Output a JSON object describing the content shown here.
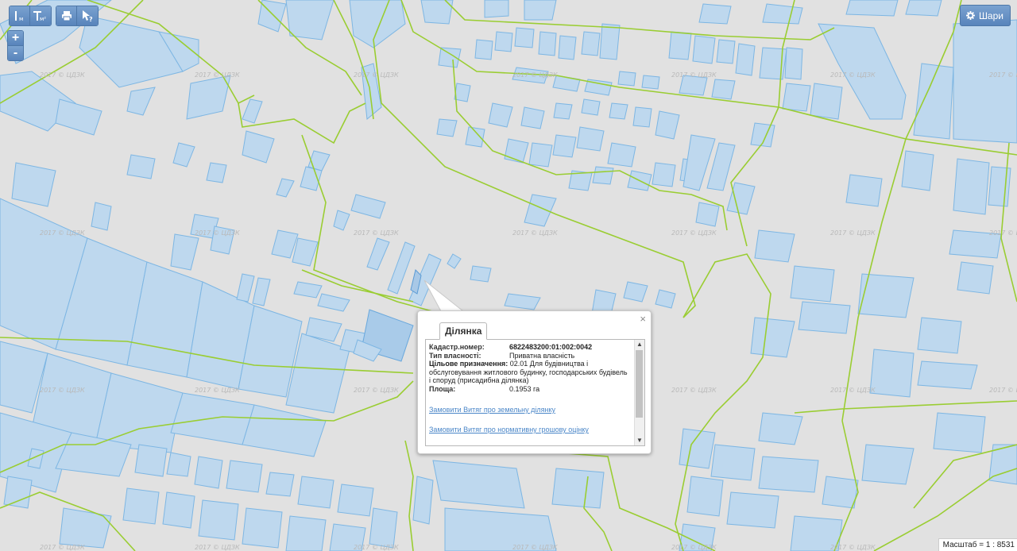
{
  "toolbar": {
    "measure_length_icon": "ruler-line-icon",
    "measure_area_icon": "ruler-area-icon",
    "print_icon": "printer-icon",
    "identify_icon": "cursor-question-icon",
    "unit_m": "м",
    "unit_m2": "м²"
  },
  "zoom": {
    "in": "+",
    "out": "-"
  },
  "layers_button": {
    "label": "Шари",
    "icon": "gear-icon"
  },
  "watermark": "2017 © ЦДЗК",
  "popup": {
    "tab": "Ділянка",
    "close": "×",
    "fields": [
      {
        "label": "Кадастр.номер:",
        "value": "6822483200:01:002:0042"
      },
      {
        "label": "Тип власності:",
        "value": "Приватна власність"
      },
      {
        "label": "Цільове призначення:",
        "value": "02.01 Для будівництва і обслуговування житлового будинку, господарських будівель і споруд (присадибна ділянка)"
      },
      {
        "label": "Площа:",
        "value": "0.1953 га"
      }
    ],
    "link_extract": "Замовити Витяг про земельну ділянку",
    "link_valuation": "Замовити Витяг про нормативну грошову оцінку"
  },
  "scale": "Масштаб = 1 : 8531",
  "colors": {
    "background": "#e1e1e1",
    "parcel_fill": "#bed8ee",
    "parcel_stroke": "#7db6e3",
    "boundary": "#9acd32",
    "button": "#6891c4"
  }
}
